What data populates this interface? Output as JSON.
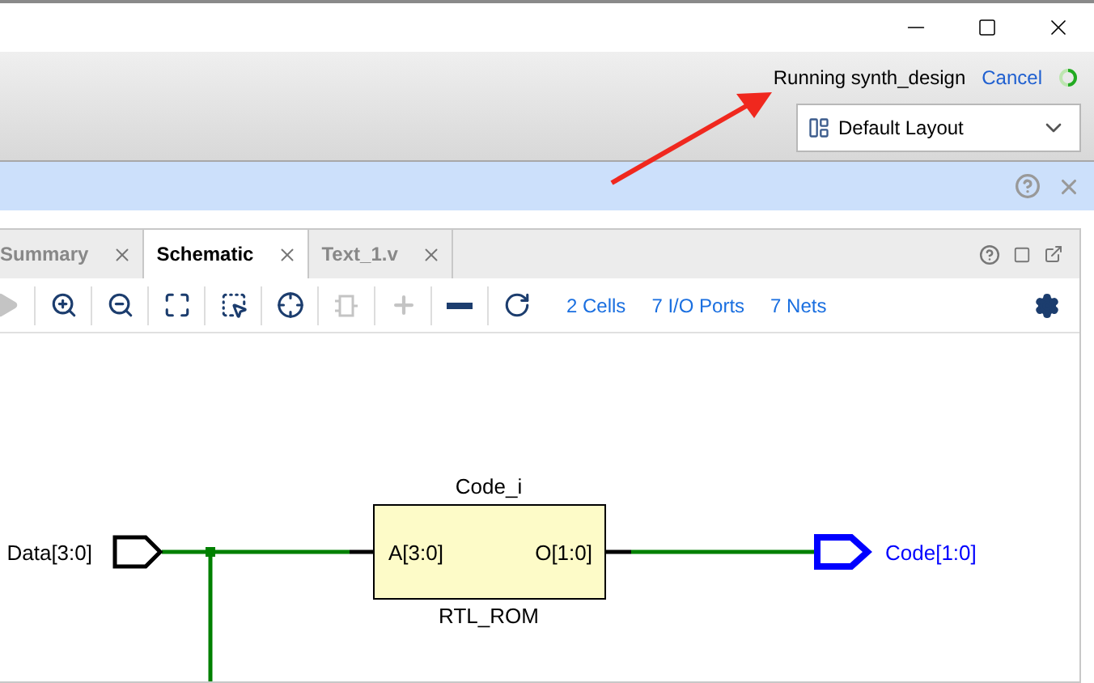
{
  "status": {
    "text": "Running synth_design",
    "action": "Cancel",
    "running": true
  },
  "layout_select": {
    "value": "Default Layout"
  },
  "tabs": [
    {
      "label": "Summary",
      "selected": false
    },
    {
      "label": "Schematic",
      "selected": true
    },
    {
      "label": "Text_1.v",
      "selected": false
    }
  ],
  "tools": [
    {
      "kind": "forward",
      "disabled": true
    },
    {
      "kind": "zoom-in",
      "disabled": false
    },
    {
      "kind": "zoom-out",
      "disabled": false
    },
    {
      "kind": "fit",
      "disabled": false
    },
    {
      "kind": "zoom-area",
      "disabled": false
    },
    {
      "kind": "target",
      "disabled": false
    },
    {
      "kind": "cell",
      "disabled": true
    },
    {
      "kind": "expand",
      "disabled": true
    },
    {
      "kind": "collapse",
      "disabled": false
    },
    {
      "kind": "refresh",
      "disabled": false
    }
  ],
  "stats": [
    "2 Cells",
    "7 I/O Ports",
    "7 Nets"
  ],
  "schematic": {
    "cell": {
      "name": "Code_i",
      "type": "RTL_ROM",
      "input_pin": "A[3:0]",
      "output_pin": "O[1:0]"
    },
    "input_port": {
      "label": "Data[3:0]",
      "selected": false
    },
    "output_port": {
      "label": "Code[1:0]",
      "selected": true
    }
  }
}
